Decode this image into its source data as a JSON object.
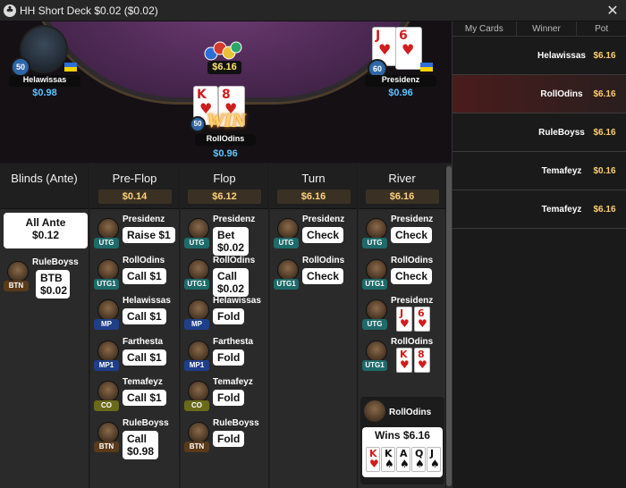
{
  "window": {
    "title": "HH  Short Deck $0.02 ($0.02)",
    "close_glyph": "✕",
    "app_icon": "♣"
  },
  "table": {
    "pot": "$6.16",
    "win_badge": "WIN",
    "players": [
      {
        "name": "Helawissas",
        "stack": "$0.98",
        "level": "50",
        "flag": "ukraine-flag"
      },
      {
        "name": "Presidenz",
        "stack": "$0.96",
        "level": "60",
        "flag": "ukraine-flag",
        "cards": [
          {
            "rank": "J",
            "suit": "♥"
          },
          {
            "rank": "6",
            "suit": "♥"
          }
        ]
      },
      {
        "name": "RollOdins",
        "stack": "$0.96",
        "level": "50",
        "cards": [
          {
            "rank": "K",
            "suit": "♥"
          },
          {
            "rank": "8",
            "suit": "♥"
          }
        ]
      }
    ]
  },
  "history": {
    "columns": [
      "My Cards",
      "Winner",
      "Pot"
    ],
    "rows": [
      {
        "winner": "Helawissas",
        "pot": "$6.16"
      },
      {
        "winner": "RollOdins",
        "pot": "$6.16"
      },
      {
        "winner": "RuleBoyss",
        "pot": "$6.16"
      },
      {
        "winner": "Temafeyz",
        "pot": "$0.16"
      },
      {
        "winner": "Temafeyz",
        "pot": "$6.16"
      }
    ]
  },
  "streets": {
    "blinds": {
      "name": "Blinds (Ante)",
      "ante_label": "All Ante",
      "ante_value": "$0.12",
      "player": "RuleBoyss",
      "pos": "BTN",
      "action": "BTB $0.02"
    },
    "preflop": {
      "name": "Pre-Flop",
      "pot": "$0.14",
      "actions": [
        {
          "player": "Presidenz",
          "pos": "UTG",
          "action": "Raise $1"
        },
        {
          "player": "RollOdins",
          "pos": "UTG1",
          "action": "Call $1"
        },
        {
          "player": "Helawissas",
          "pos": "MP",
          "action": "Call $1"
        },
        {
          "player": "Farthesta",
          "pos": "MP1",
          "action": "Call $1"
        },
        {
          "player": "Temafeyz",
          "pos": "CO",
          "action": "Call $1"
        },
        {
          "player": "RuleBoyss",
          "pos": "BTN",
          "action": "Call $0.98"
        }
      ]
    },
    "flop": {
      "name": "Flop",
      "pot": "$6.12",
      "actions": [
        {
          "player": "Presidenz",
          "pos": "UTG",
          "action": "Bet $0.02"
        },
        {
          "player": "RollOdins",
          "pos": "UTG1",
          "action": "Call $0.02"
        },
        {
          "player": "Helawissas",
          "pos": "MP",
          "action": "Fold"
        },
        {
          "player": "Farthesta",
          "pos": "MP1",
          "action": "Fold"
        },
        {
          "player": "Temafeyz",
          "pos": "CO",
          "action": "Fold"
        },
        {
          "player": "RuleBoyss",
          "pos": "BTN",
          "action": "Fold"
        }
      ]
    },
    "turn": {
      "name": "Turn",
      "pot": "$6.16",
      "actions": [
        {
          "player": "Presidenz",
          "pos": "UTG",
          "action": "Check"
        },
        {
          "player": "RollOdins",
          "pos": "UTG1",
          "action": "Check"
        }
      ]
    },
    "river": {
      "name": "River",
      "pot": "$6.16",
      "actions": [
        {
          "player": "Presidenz",
          "pos": "UTG",
          "action": "Check"
        },
        {
          "player": "RollOdins",
          "pos": "UTG1",
          "action": "Check"
        },
        {
          "player": "Presidenz",
          "pos": "UTG",
          "show": [
            {
              "rank": "J",
              "suit": "♥"
            },
            {
              "rank": "6",
              "suit": "♥"
            }
          ]
        },
        {
          "player": "RollOdins",
          "pos": "UTG1",
          "show": [
            {
              "rank": "K",
              "suit": "♥"
            },
            {
              "rank": "8",
              "suit": "♥"
            }
          ]
        }
      ],
      "winner": {
        "player": "RollOdins",
        "label": "Wins $6.16",
        "hand": [
          {
            "rank": "K",
            "suit": "♥",
            "color": "red"
          },
          {
            "rank": "K",
            "suit": "♠",
            "color": "black"
          },
          {
            "rank": "A",
            "suit": "♠",
            "color": "black"
          },
          {
            "rank": "Q",
            "suit": "♠",
            "color": "black"
          },
          {
            "rank": "J",
            "suit": "♠",
            "color": "black"
          }
        ]
      }
    }
  }
}
